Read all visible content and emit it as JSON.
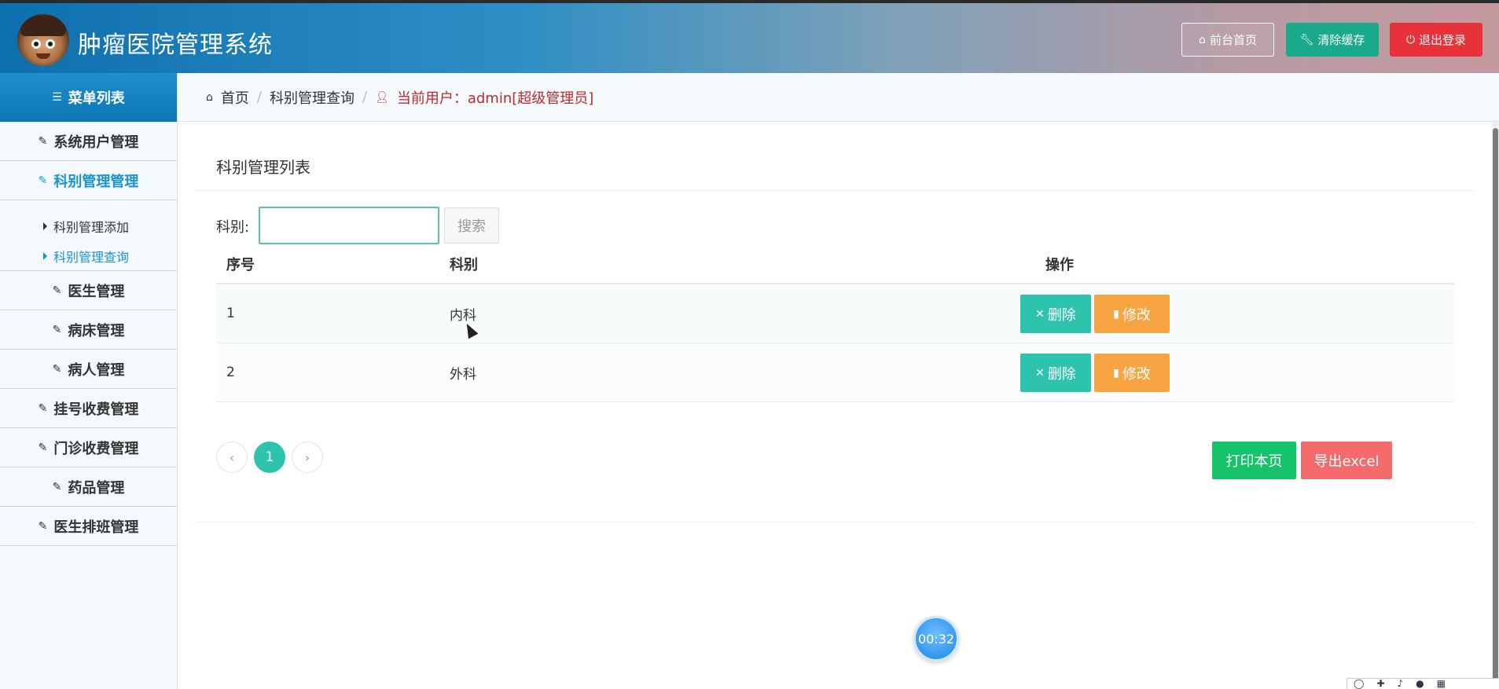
{
  "header": {
    "title": "肿瘤医院管理系统",
    "buttons": {
      "home": "前台首页",
      "clear_cache": "清除缓存",
      "logout": "退出登录"
    }
  },
  "sidebar": {
    "menu_title": "菜单列表",
    "items": [
      {
        "label": "系统用户管理"
      },
      {
        "label": "科别管理管理"
      },
      {
        "label": "医生管理"
      },
      {
        "label": "病床管理"
      },
      {
        "label": "病人管理"
      },
      {
        "label": "挂号收费管理"
      },
      {
        "label": "门诊收费管理"
      },
      {
        "label": "药品管理"
      },
      {
        "label": "医生排班管理"
      }
    ],
    "submenu": [
      {
        "label": "科别管理添加"
      },
      {
        "label": "科别管理查询"
      }
    ]
  },
  "breadcrumb": {
    "home": "首页",
    "current": "科别管理查询",
    "user": "当前用户：admin[超级管理员]"
  },
  "main": {
    "panel_title": "科别管理列表",
    "search": {
      "label": "科别:",
      "value": "",
      "placeholder": "",
      "button": "搜索"
    },
    "table": {
      "headers": {
        "no": "序号",
        "dept": "科别",
        "op": "操作"
      },
      "rows": [
        {
          "no": "1",
          "dept": "内科"
        },
        {
          "no": "2",
          "dept": "外科"
        }
      ],
      "actions": {
        "delete": "删除",
        "edit": "修改"
      }
    },
    "pager": {
      "prev": "‹",
      "current": "1",
      "next": "›"
    },
    "buttons": {
      "print": "打印本页",
      "export": "导出excel"
    }
  },
  "overlay": {
    "timer": "00:32"
  },
  "colors": {
    "accent": "#1a93d0",
    "danger": "#e8323b",
    "teal": "#2ec3ad",
    "orange": "#f7a543",
    "green": "#16c36b",
    "export": "#f56a6a"
  }
}
